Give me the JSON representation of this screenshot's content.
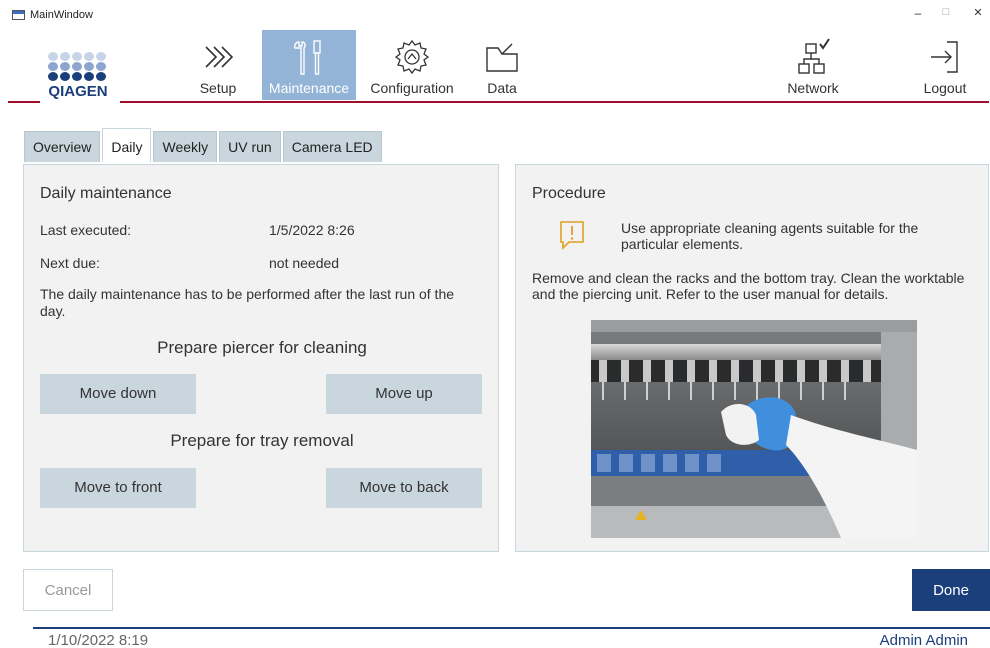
{
  "window": {
    "title": "MainWindow",
    "minimize": "–",
    "maximize": "□",
    "close": "✕"
  },
  "brand": {
    "logo_text": "QIAGEN",
    "colors": {
      "accent": "#a0102e",
      "navy": "#1b3f7a",
      "active_nav": "#93b4d6"
    }
  },
  "nav": {
    "setup": "Setup",
    "maintenance": "Maintenance",
    "configuration": "Configuration",
    "data": "Data",
    "network": "Network",
    "logout": "Logout",
    "active": "maintenance"
  },
  "tabs": [
    "Overview",
    "Daily",
    "Weekly",
    "UV run",
    "Camera LED"
  ],
  "active_tab": "Daily",
  "daily": {
    "title": "Daily maintenance",
    "last_executed_label": "Last executed:",
    "last_executed_value": "1/5/2022 8:26",
    "next_due_label": "Next due:",
    "next_due_value": "not needed",
    "note": "The daily maintenance has to be performed after the last run of the day.",
    "piercer_title": "Prepare piercer for cleaning",
    "move_down": "Move down",
    "move_up": "Move up",
    "tray_title": "Prepare for tray removal",
    "move_front": "Move to front",
    "move_back": "Move to back"
  },
  "procedure": {
    "title": "Procedure",
    "warning": "Use appropriate cleaning agents suitable for the particular elements.",
    "text": "Remove and clean the racks and the bottom tray. Clean the worktable and the piercing unit. Refer to the user manual for details."
  },
  "footer": {
    "cancel": "Cancel",
    "done": "Done",
    "datetime": "1/10/2022 8:19",
    "user": "Admin Admin"
  }
}
